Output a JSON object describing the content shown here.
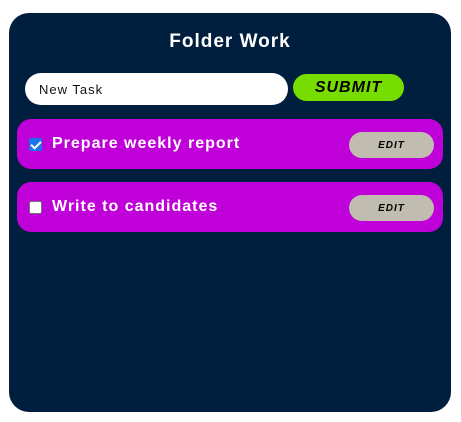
{
  "header": {
    "title": "Folder Work"
  },
  "form": {
    "input_value": "New Task",
    "submit_label": "SUBMIT"
  },
  "tasks": [
    {
      "label": "Prepare weekly report",
      "checked": true,
      "edit_label": "EDIT"
    },
    {
      "label": "Write to candidates",
      "checked": false,
      "edit_label": "EDIT"
    }
  ],
  "colors": {
    "card_background": "#001f3f",
    "task_background": "#c000d8",
    "submit_background": "#77dd00",
    "edit_background": "#c0bcb0"
  }
}
